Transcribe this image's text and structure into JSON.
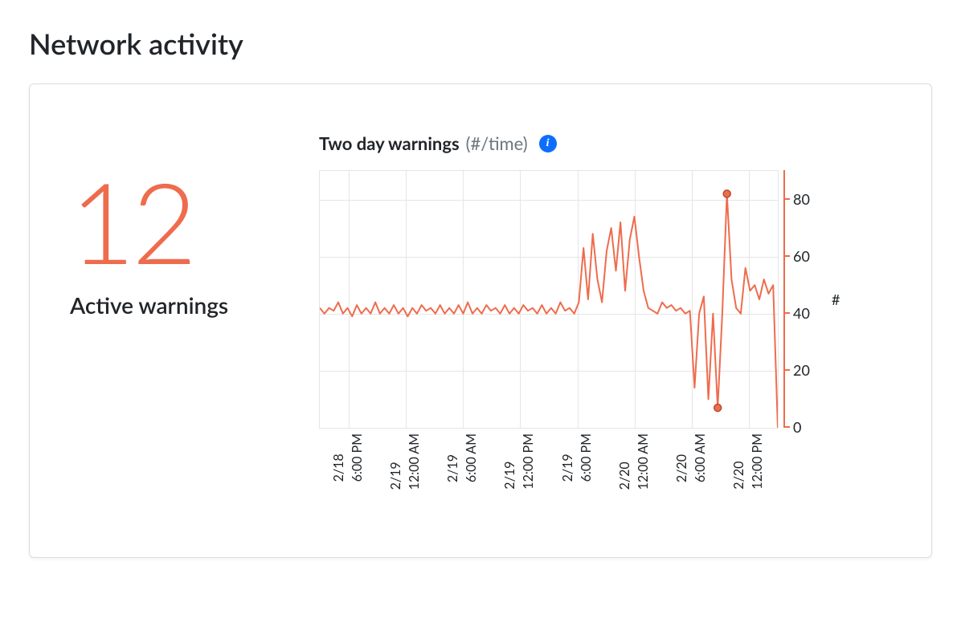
{
  "page": {
    "title": "Network activity"
  },
  "kpi": {
    "value": "12",
    "label": "Active warnings"
  },
  "chart": {
    "title": "Two day warnings",
    "subtitle": "(#/time)",
    "ylabel": "#",
    "yticks": [
      0,
      20,
      40,
      60,
      80
    ],
    "xticks": [
      "2/18 6:00 PM",
      "2/19 12:00 AM",
      "2/19 6:00 AM",
      "2/19 12:00 PM",
      "2/19 6:00 PM",
      "2/20 12:00 AM",
      "2/20 6:00 AM",
      "2/20 12:00 PM"
    ]
  },
  "chart_data": {
    "type": "line",
    "title": "Two day warnings (#/time)",
    "xlabel": "",
    "ylabel": "#",
    "ylim": [
      0,
      90
    ],
    "x_major_ticks": [
      "2/18 6:00 PM",
      "2/19 12:00 AM",
      "2/19 6:00 AM",
      "2/19 12:00 PM",
      "2/19 6:00 PM",
      "2/20 12:00 AM",
      "2/20 6:00 AM",
      "2/20 12:00 PM"
    ],
    "x": [
      0,
      1,
      2,
      3,
      4,
      5,
      6,
      7,
      8,
      9,
      10,
      11,
      12,
      13,
      14,
      15,
      16,
      17,
      18,
      19,
      20,
      21,
      22,
      23,
      24,
      25,
      26,
      27,
      28,
      29,
      30,
      31,
      32,
      33,
      34,
      35,
      36,
      37,
      38,
      39,
      40,
      41,
      42,
      43,
      44,
      45,
      46,
      47,
      48,
      49,
      50,
      51,
      52,
      53,
      54,
      55,
      56,
      57,
      58,
      59,
      60,
      61,
      62,
      63,
      64,
      65,
      66,
      67,
      68,
      69,
      70,
      71,
      72,
      73,
      74,
      75,
      76,
      77,
      78,
      79,
      80,
      81,
      82,
      83,
      84,
      85,
      86,
      87,
      88,
      89,
      90,
      91,
      92,
      93,
      94,
      95,
      96,
      97,
      98,
      99
    ],
    "values": [
      42,
      40,
      42,
      41,
      44,
      40,
      42,
      39,
      43,
      40,
      42,
      40,
      44,
      40,
      42,
      40,
      43,
      40,
      42,
      39,
      42,
      40,
      43,
      41,
      42,
      40,
      43,
      40,
      42,
      40,
      43,
      40,
      44,
      40,
      42,
      40,
      43,
      41,
      42,
      40,
      43,
      40,
      42,
      40,
      43,
      41,
      42,
      40,
      43,
      40,
      42,
      40,
      44,
      41,
      42,
      40,
      44,
      63,
      45,
      68,
      52,
      44,
      62,
      70,
      55,
      72,
      48,
      66,
      74,
      60,
      48,
      42,
      41,
      40,
      44,
      42,
      43,
      41,
      42,
      40,
      41,
      14,
      40,
      46,
      10,
      40,
      7,
      40,
      82,
      52,
      42,
      40,
      56,
      48,
      50,
      45,
      52,
      47,
      50,
      0
    ],
    "highlighted_points": [
      {
        "x": 86,
        "y": 7
      },
      {
        "x": 88,
        "y": 82
      }
    ]
  },
  "colors": {
    "accent": "#ee6c4d"
  }
}
